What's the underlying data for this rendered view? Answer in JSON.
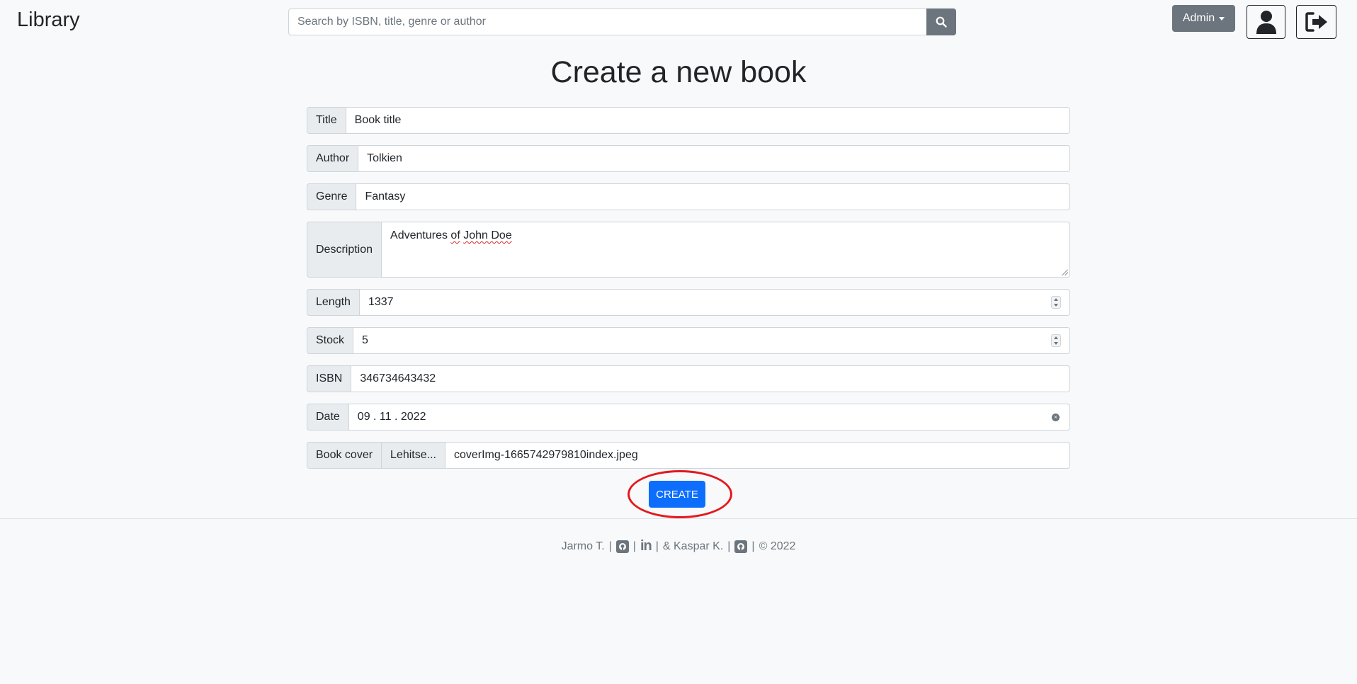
{
  "header": {
    "brand": "Library",
    "search_placeholder": "Search by ISBN, title, genre or author",
    "admin_label": "Admin"
  },
  "page_title": "Create a new book",
  "form": {
    "title": {
      "label": "Title",
      "value": "Book title"
    },
    "author": {
      "label": "Author",
      "value": "Tolkien"
    },
    "genre": {
      "label": "Genre",
      "value": "Fantasy"
    },
    "description": {
      "label": "Description",
      "value_before": "Adventures ",
      "value_misspelled_1": "of",
      "value_mid": " ",
      "value_misspelled_2": "John Doe"
    },
    "length": {
      "label": "Length",
      "value": "1337"
    },
    "stock": {
      "label": "Stock",
      "value": "5"
    },
    "isbn": {
      "label": "ISBN",
      "value": "346734643432"
    },
    "date": {
      "label": "Date",
      "value": "09 . 11 . 2022"
    },
    "cover": {
      "label": "Book cover",
      "browse_label": "Lehitse...",
      "filename": "coverImg-1665742979810index.jpeg"
    }
  },
  "create_label": "CREATE",
  "footer": {
    "author1": "Jarmo T.",
    "sep": "|",
    "linkedin": "in",
    "author2": "& Kaspar K.",
    "copyright": "© 2022"
  },
  "icons": {
    "search": "search-icon",
    "user": "user-icon",
    "logout": "logout-icon",
    "github": "github-icon",
    "linkedin": "linkedin-icon"
  },
  "colors": {
    "primary": "#0d6efd",
    "secondary": "#6c757d",
    "highlight": "#e3191e"
  }
}
